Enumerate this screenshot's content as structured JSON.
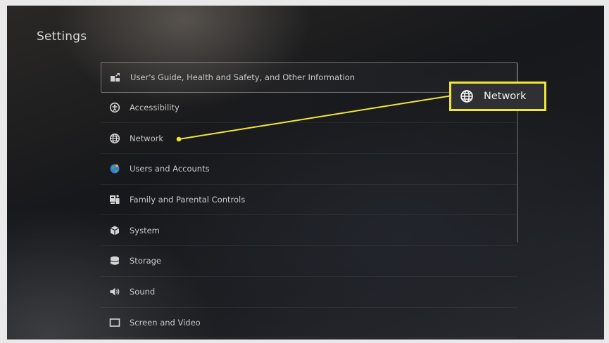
{
  "header": {
    "title": "Settings"
  },
  "menu": {
    "items": [
      {
        "label": "User's Guide, Health and Safety, and Other Information",
        "icon": "user-guide-icon"
      },
      {
        "label": "Accessibility",
        "icon": "accessibility-icon"
      },
      {
        "label": "Network",
        "icon": "globe-icon"
      },
      {
        "label": "Users and Accounts",
        "icon": "users-accounts-icon"
      },
      {
        "label": "Family and Parental Controls",
        "icon": "family-controls-icon"
      },
      {
        "label": "System",
        "icon": "system-cube-icon"
      },
      {
        "label": "Storage",
        "icon": "storage-icon"
      },
      {
        "label": "Sound",
        "icon": "speaker-icon"
      },
      {
        "label": "Screen and Video",
        "icon": "screen-icon"
      }
    ],
    "selected_index": 0
  },
  "callout": {
    "label": "Network",
    "icon": "globe-icon",
    "highlight_color": "#f2e53a"
  }
}
